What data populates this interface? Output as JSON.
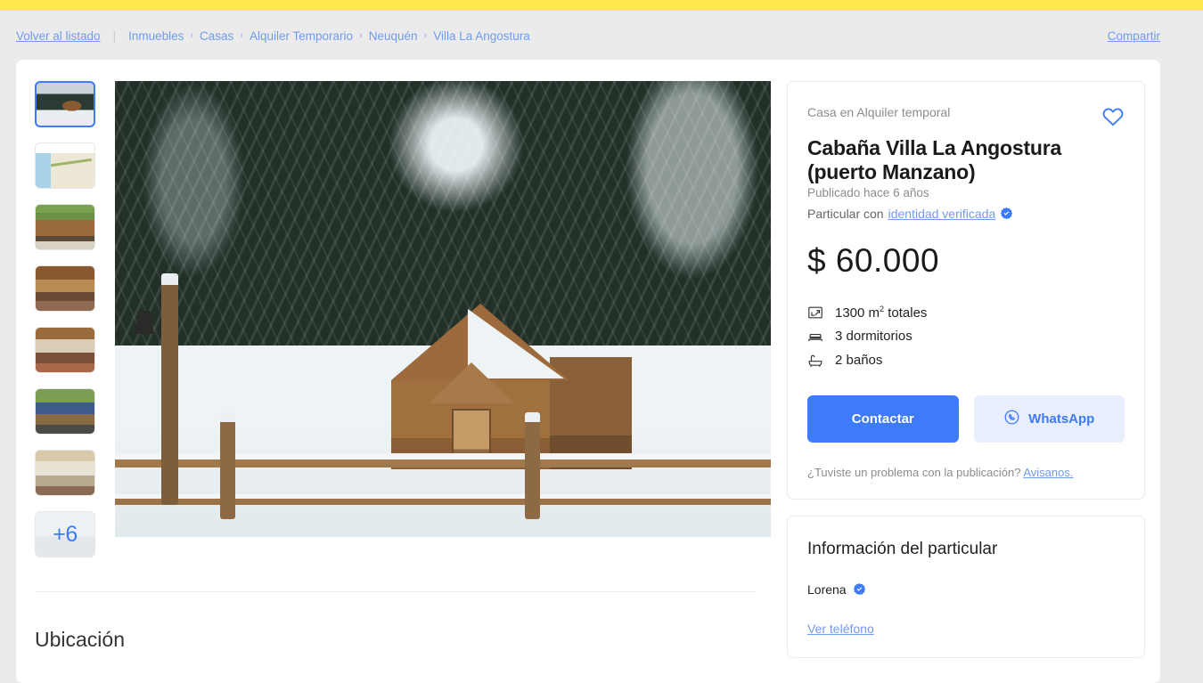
{
  "theme": {
    "brand_yellow": "#ffe94f",
    "link_blue": "#6f9bf0",
    "accent_blue": "#3e7bfa",
    "page_bg": "#ebebeb"
  },
  "breadcrumb": {
    "back_label": "Volver al listado",
    "separator": "|",
    "chevron": "›",
    "items": [
      {
        "label": "Inmuebles"
      },
      {
        "label": "Casas"
      },
      {
        "label": "Alquiler Temporario"
      },
      {
        "label": "Neuquén"
      },
      {
        "label": "Villa La Angostura"
      }
    ],
    "share_label": "Compartir"
  },
  "gallery": {
    "thumbnails": [
      {
        "name": "cabin-snow-exterior",
        "art": "art-cabin-snow",
        "selected": true
      },
      {
        "name": "location-map",
        "art": "art-map",
        "selected": false
      },
      {
        "name": "cabin-daytime-exterior",
        "art": "art-cabin-day",
        "selected": false
      },
      {
        "name": "interior-living-room",
        "art": "art-interior-1",
        "selected": false
      },
      {
        "name": "interior-dining-room",
        "art": "art-interior-2",
        "selected": false
      },
      {
        "name": "cabin-blue-roof",
        "art": "art-cabin-blue",
        "selected": false
      },
      {
        "name": "bedroom",
        "art": "art-bedroom",
        "selected": false
      }
    ],
    "more_label": "+6",
    "hero_alt": "Cabaña de madera cubierta de nieve entre pinos"
  },
  "location_section": {
    "title": "Ubicación"
  },
  "listing": {
    "condition": "Casa en Alquiler temporal",
    "title": "Cabaña Villa La Angostura (puerto Manzano)",
    "published": "Publicado hace 6 años",
    "seller_prefix": "Particular con",
    "seller_verified_link": "identidad verificada",
    "price": "$ 60.000",
    "features": [
      {
        "icon": "area-icon",
        "value": "1300 m",
        "sup": "2",
        "suffix": " totales"
      },
      {
        "icon": "bed-icon",
        "value": "3 dormitorios",
        "sup": "",
        "suffix": ""
      },
      {
        "icon": "bath-icon",
        "value": "2 baños",
        "sup": "",
        "suffix": ""
      }
    ],
    "contact_label": "Contactar",
    "whatsapp_label": "WhatsApp",
    "problem_text": "¿Tuviste un problema con la publicación?",
    "problem_link": "Avisanos."
  },
  "seller_info": {
    "title": "Información del particular",
    "name": "Lorena",
    "phone_link": "Ver teléfono"
  }
}
